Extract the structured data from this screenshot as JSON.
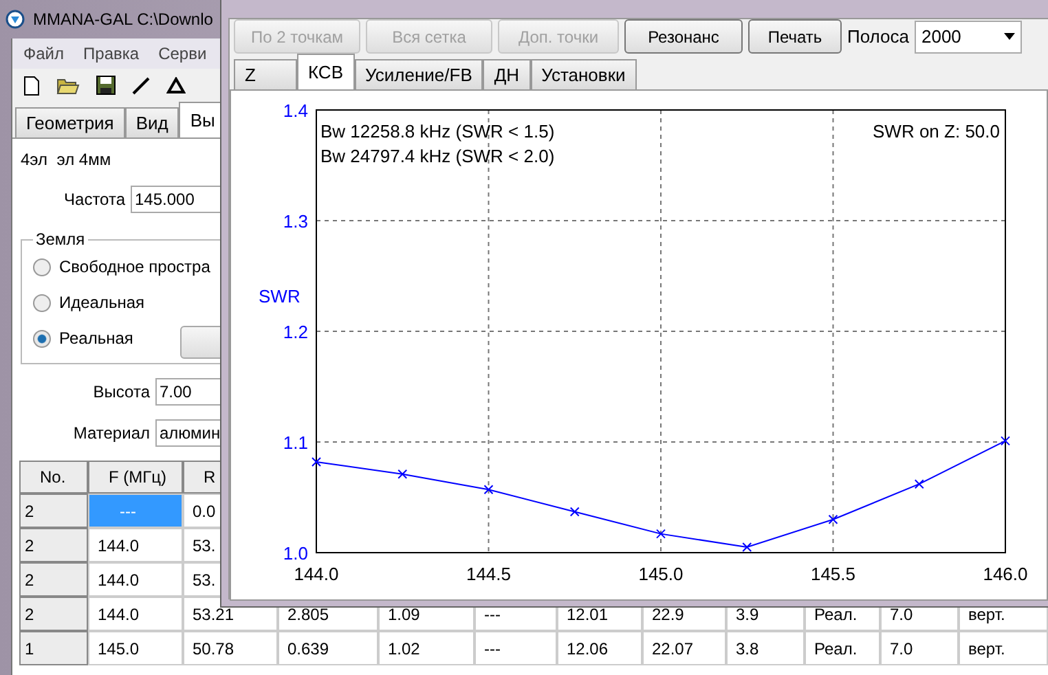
{
  "main_window": {
    "title": "MMANA-GAL C:\\Downlo",
    "menu": [
      "Файл",
      "Правка",
      "Серви"
    ],
    "tabs": [
      {
        "label": "Геометрия",
        "selected": false
      },
      {
        "label": "Вид",
        "selected": false
      },
      {
        "label": "Вы",
        "selected": true
      }
    ],
    "antenna_name": "4эл  эл 4мм",
    "frequency": {
      "label": "Частота",
      "value": "145.000"
    },
    "ground": {
      "title": "Земля",
      "options": [
        {
          "label": "Свободное простра",
          "selected": false
        },
        {
          "label": "Идеальная",
          "selected": false
        },
        {
          "label": "Реальная",
          "selected": true
        }
      ]
    },
    "height": {
      "label": "Высота",
      "value": "7.00"
    },
    "material": {
      "label": "Материал",
      "value": "алюмин"
    },
    "table": {
      "columns": [
        "No.",
        "F (МГц)",
        "R"
      ],
      "rows": [
        {
          "cells": [
            {
              "text": "2",
              "selected": false
            },
            {
              "text": "---",
              "selected": true
            },
            {
              "text": "0.0",
              "selected": false
            }
          ]
        },
        {
          "cells": [
            {
              "text": "2",
              "selected": false
            },
            {
              "text": "144.0",
              "selected": false
            },
            {
              "text": "53.",
              "selected": false
            }
          ]
        },
        {
          "cells": [
            {
              "text": "2",
              "selected": false
            },
            {
              "text": "144.0",
              "selected": false
            },
            {
              "text": "53.",
              "selected": false
            }
          ]
        },
        {
          "cells": [
            {
              "text": "2",
              "selected": false
            },
            {
              "text": "144.0",
              "selected": false
            },
            {
              "text": "53.21",
              "selected": false
            },
            {
              "text": "2.805",
              "selected": false
            },
            {
              "text": "1.09",
              "selected": false
            },
            {
              "text": "---",
              "selected": false
            },
            {
              "text": "12.01",
              "selected": false
            },
            {
              "text": "22.9",
              "selected": false
            },
            {
              "text": "3.9",
              "selected": false
            },
            {
              "text": "Реал.",
              "selected": false
            },
            {
              "text": "7.0",
              "selected": false
            },
            {
              "text": "верт.",
              "selected": false
            }
          ]
        },
        {
          "cells": [
            {
              "text": "1",
              "selected": false
            },
            {
              "text": "145.0",
              "selected": false
            },
            {
              "text": "50.78",
              "selected": false
            },
            {
              "text": "0.639",
              "selected": false
            },
            {
              "text": "1.02",
              "selected": false
            },
            {
              "text": "---",
              "selected": false
            },
            {
              "text": "12.06",
              "selected": false
            },
            {
              "text": "22.07",
              "selected": false
            },
            {
              "text": "3.8",
              "selected": false
            },
            {
              "text": "Реал.",
              "selected": false
            },
            {
              "text": "7.0",
              "selected": false
            },
            {
              "text": "верт.",
              "selected": false
            }
          ]
        }
      ]
    }
  },
  "graph_window": {
    "buttons": [
      {
        "label": "По 2 точкам",
        "disabled": true
      },
      {
        "label": "Вся сетка",
        "disabled": true
      },
      {
        "label": "Доп. точки",
        "disabled": true
      },
      {
        "label": "Резонанс",
        "disabled": false
      },
      {
        "label": "Печать",
        "disabled": false
      }
    ],
    "band": {
      "label": "Полоса",
      "value": "2000"
    },
    "tabs": [
      {
        "label": "Z",
        "selected": false
      },
      {
        "label": "КСВ",
        "selected": true
      },
      {
        "label": "Усиление/FB",
        "selected": false
      },
      {
        "label": "ДН",
        "selected": false
      },
      {
        "label": "Установки",
        "selected": false
      }
    ],
    "chart_data": {
      "type": "line",
      "ylabel": "SWR",
      "x": [
        144.0,
        144.25,
        144.5,
        144.75,
        145.0,
        145.25,
        145.5,
        145.75,
        146.0
      ],
      "grid": true,
      "series": [
        {
          "color": "#0000ff",
          "marker": "x",
          "values": [
            1.082,
            1.071,
            1.057,
            1.037,
            1.017,
            1.005,
            1.03,
            1.062,
            1.101
          ]
        }
      ],
      "xlim": [
        144.0,
        146.0
      ],
      "ylim": [
        1.0,
        1.4
      ],
      "xticks": [
        {
          "value": 144.0,
          "label": "144.0"
        },
        {
          "value": 144.5,
          "label": "144.5"
        },
        {
          "value": 145.0,
          "label": "145.0"
        },
        {
          "value": 145.5,
          "label": "145.5"
        },
        {
          "value": 146.0,
          "label": "146.0"
        }
      ],
      "yticks": [
        {
          "value": 1.0,
          "label": "1.0"
        },
        {
          "value": 1.1,
          "label": "1.1"
        },
        {
          "value": 1.2,
          "label": "1.2"
        },
        {
          "value": 1.3,
          "label": "1.3"
        },
        {
          "value": 1.4,
          "label": "1.4"
        }
      ],
      "annotations": [
        "Bw 12258.8 kHz (SWR < 1.5)",
        "Bw 24797.4 kHz (SWR < 2.0)",
        "SWR on Z: 50.0"
      ]
    }
  }
}
